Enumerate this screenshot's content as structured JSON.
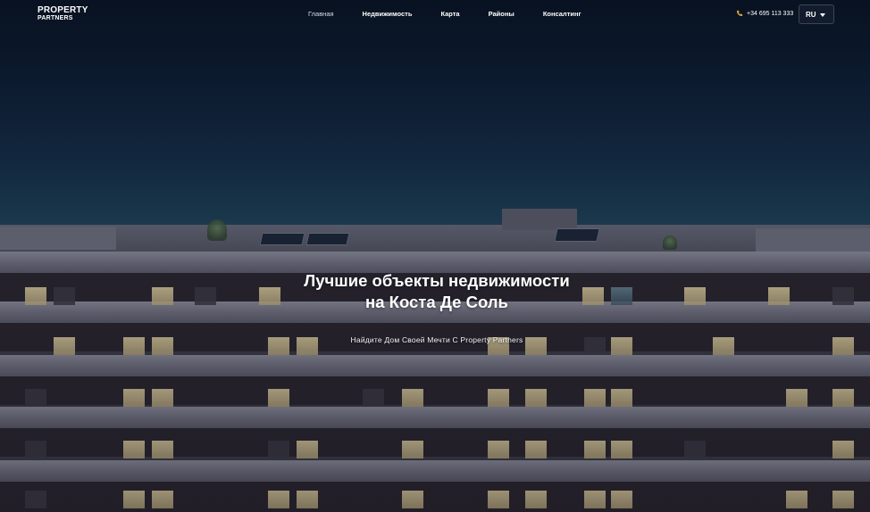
{
  "brand": {
    "line1": "PROPERTY",
    "line2": "PARTNERS"
  },
  "nav": {
    "items": [
      {
        "label": "Главная",
        "active": true
      },
      {
        "label": "Недвижимость",
        "active": false
      },
      {
        "label": "Карта",
        "active": false
      },
      {
        "label": "Районы",
        "active": false
      },
      {
        "label": "Консалтинг",
        "active": false
      }
    ]
  },
  "contact": {
    "phone": "+34 695 113 333",
    "icon": "phone-icon",
    "icon_color": "#d9a24a"
  },
  "language": {
    "selected": "RU"
  },
  "hero": {
    "title": "Лучшие объекты недвижимости на Коста Де Соль",
    "subtitle": "Найдите Дом Своей Мечти С Property Partners",
    "background": "building-at-dusk-photo"
  }
}
